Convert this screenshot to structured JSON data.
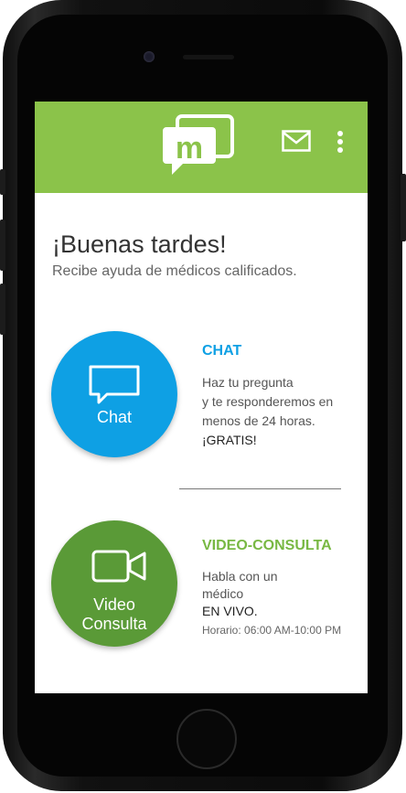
{
  "greeting": "¡Buenas tardes!",
  "subtitle": "Recibe ayuda de médicos calificados.",
  "chat": {
    "button_label": "Chat",
    "title": "CHAT",
    "lines": [
      "Haz tu pregunta",
      "y te responderemos en",
      "menos de 24 horas.",
      "¡GRATIS!"
    ]
  },
  "video": {
    "button_label_line1": "Video",
    "button_label_line2": "Consulta",
    "title": "VIDEO-CONSULTA",
    "lines": [
      "Habla con un",
      "médico",
      "EN VIVO."
    ],
    "hours": "Horario: 06:00 AM-10:00 PM"
  },
  "logo_letter": "m",
  "icons": [
    "logo-icon",
    "mail-icon",
    "overflow-menu-icon",
    "chat-bubble-icon",
    "video-camera-icon"
  ],
  "colors": {
    "appbar": "#8bc34a",
    "chat": "#0ea0e4",
    "video": "#5a9a37",
    "chat_title": "#0ea0e4",
    "video_title": "#78b843"
  }
}
